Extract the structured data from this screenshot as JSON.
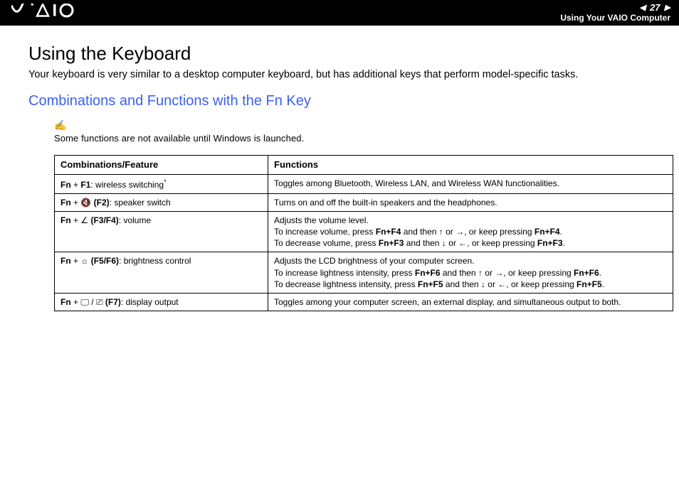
{
  "header": {
    "logo_text": "VAIO",
    "page_number": "27",
    "section": "Using Your VAIO Computer",
    "prev_symbol": "◀",
    "next_symbol": "▶"
  },
  "h1": "Using the Keyboard",
  "intro": "Your keyboard is very similar to a desktop computer keyboard, but has additional keys that perform model-specific tasks.",
  "h2": "Combinations and Functions with the Fn Key",
  "note": {
    "icon": "✍",
    "text": "Some functions are not available until Windows is launched."
  },
  "table": {
    "header": {
      "col1": "Combinations/Feature",
      "col2": "Functions"
    },
    "rows": [
      {
        "combo_prefix": "Fn",
        "plus1": " + ",
        "key1": "F1",
        "combo_suffix": ": wireless switching",
        "asterisk": "*",
        "func_html": "Toggles among Bluetooth, Wireless LAN, and Wireless WAN functionalities."
      },
      {
        "combo_prefix": "Fn",
        "plus1": " + ",
        "icon1": "🔇",
        "key1_wrap_open": " (",
        "key1": "F2",
        "key1_wrap_close": ")",
        "combo_suffix": ": speaker switch",
        "func_html": "Turns on and off the built-in speakers and the headphones."
      },
      {
        "combo_prefix": "Fn",
        "plus1": " + ",
        "icon1": "∠",
        "key1_wrap_open": " (",
        "key1": "F3/F4",
        "key1_wrap_close": ")",
        "combo_suffix": ": volume",
        "func_lines": [
          {
            "pre": "Adjusts the volume level."
          },
          {
            "pre": "To increase volume, press ",
            "b1": "Fn+F4",
            "mid": " and then ",
            "s1": "↑",
            "mid2": " or ",
            "s2": "→",
            "mid3": ", or keep pressing ",
            "b2": "Fn+F4",
            "post": "."
          },
          {
            "pre": "To decrease volume, press ",
            "b1": "Fn+F3",
            "mid": " and then ",
            "s1": "↓",
            "mid2": " or ",
            "s2": "←",
            "mid3": ", or keep pressing ",
            "b2": "Fn+F3",
            "post": "."
          }
        ]
      },
      {
        "combo_prefix": "Fn",
        "plus1": " + ",
        "icon1": "☼",
        "key1_wrap_open": " (",
        "key1": "F5/F6",
        "key1_wrap_close": ")",
        "combo_suffix": ": brightness control",
        "func_lines": [
          {
            "pre": "Adjusts the LCD brightness of your computer screen."
          },
          {
            "pre": "To increase lightness intensity, press ",
            "b1": "Fn+F6",
            "mid": " and then ",
            "s1": "↑",
            "mid2": " or ",
            "s2": "→",
            "mid3": ", or keep pressing ",
            "b2": "Fn+F6",
            "post": "."
          },
          {
            "pre": "To decrease lightness intensity, press ",
            "b1": "Fn+F5",
            "mid": " and then ",
            "s1": "↓",
            "mid2": " or ",
            "s2": "←",
            "mid3": ", or keep pressing ",
            "b2": "Fn+F5",
            "post": "."
          }
        ]
      },
      {
        "combo_prefix": "Fn",
        "plus1": " + ",
        "icon1": "🖵",
        "icon_sep": " / ",
        "icon2": "⎚",
        "key1_wrap_open": " (",
        "key1": "F7",
        "key1_wrap_close": ")",
        "combo_suffix": ": display output",
        "func_html": "Toggles among your computer screen, an external display, and simultaneous output to both."
      }
    ]
  }
}
